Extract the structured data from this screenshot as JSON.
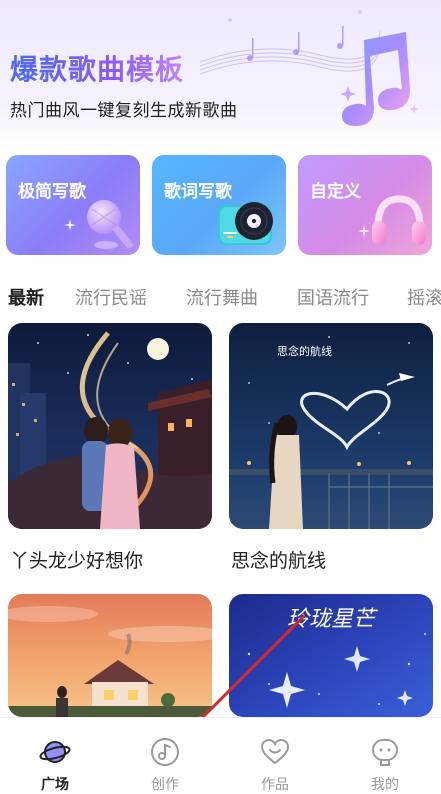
{
  "hero": {
    "title": "爆款歌曲模板",
    "subtitle": "热门曲风一键复刻生成新歌曲"
  },
  "feature_cards": [
    {
      "label": "极简写歌",
      "icon": "microphone-icon"
    },
    {
      "label": "歌词写歌",
      "icon": "vinyl-record-icon"
    },
    {
      "label": "自定义",
      "icon": "headphones-icon"
    }
  ],
  "category_tabs": [
    {
      "label": "最新",
      "active": true
    },
    {
      "label": "流行民谣",
      "active": false
    },
    {
      "label": "流行舞曲",
      "active": false
    },
    {
      "label": "国语流行",
      "active": false
    },
    {
      "label": "摇滚",
      "active": false
    }
  ],
  "songs": [
    {
      "title": "丫头龙少好想你",
      "cover_text": ""
    },
    {
      "title": "思念的航线",
      "cover_text": "思念的航线"
    },
    {
      "title": "",
      "cover_text": ""
    },
    {
      "title": "",
      "cover_text": "玲珑星芒"
    }
  ],
  "bottom_nav": [
    {
      "label": "广场",
      "icon": "planet-icon",
      "active": true
    },
    {
      "label": "创作",
      "icon": "music-note-icon",
      "active": false
    },
    {
      "label": "作品",
      "icon": "heart-icon",
      "active": false
    },
    {
      "label": "我的",
      "icon": "profile-icon",
      "active": false
    }
  ],
  "colors": {
    "accent": "#8b5cf6",
    "annotation_arrow": "#d62828"
  }
}
